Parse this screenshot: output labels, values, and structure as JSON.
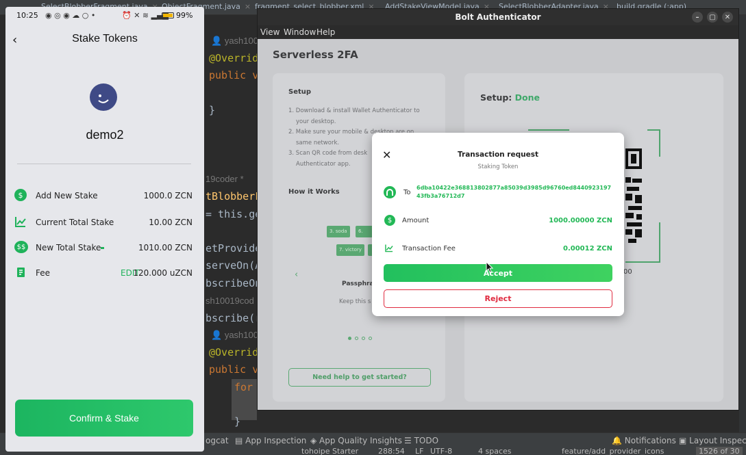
{
  "ide": {
    "tabs": [
      "SelectBlobberFragment.java",
      "ObjectFragment.java",
      "fragment_select_blobber.xml",
      "AddStakeViewModel.java",
      "SelectBlobberAdapter.java",
      "build.gradle (:app)"
    ],
    "code_lines": {
      "author1": "yash100",
      "override1": "@Overrid",
      "public1": "public v",
      "brace1": "}",
      "coder": "19coder *",
      "blobberF": "tBlobberF",
      "thisget": "= this.ge",
      "provide": "etProvide",
      "serveon": "serveOn(A",
      "subscribeon": "bscribeOn",
      "author2": "sh10019cod",
      "subscribe": "bscribe(r",
      "author3": "yash100",
      "override2": "@Overrid",
      "public2": "public v",
      "for": "for",
      "brace2": "}"
    },
    "tool_windows": [
      "ogcat",
      "App Inspection",
      "App Quality Insights",
      "TODO",
      "Notifications",
      "Layout Inspector"
    ],
    "status": [
      "tohoipe Starter",
      "288:54",
      "LF",
      "UTF-8",
      "4 spaces",
      "feature/add_provider_icons",
      "1526 of 30"
    ]
  },
  "phone": {
    "status_time": "10:25",
    "status_battery": "99%",
    "title": "Stake Tokens",
    "username": "demo2",
    "rows": [
      {
        "label": "Add New Stake",
        "value": "1000.0 ZCN"
      },
      {
        "label": "Current Total Stake",
        "value": "10.00 ZCN"
      },
      {
        "label": "New Total Stake",
        "value": "1010.00 ZCN"
      },
      {
        "label": "Fee",
        "edit": "EDIT",
        "value": "120.000 uZCN"
      }
    ],
    "confirm_label": "Confirm & Stake"
  },
  "bolt": {
    "window_title": "Bolt Authenticator",
    "menu": [
      "View",
      "Window",
      "Help"
    ],
    "heading": "Serverless 2FA",
    "setup_title": "Setup",
    "setup_steps": [
      "1. Download & install Wallet Authenticator to",
      "your desktop.",
      "2. Make sure your mobile & desktop are on",
      "same network.",
      "3. Scan QR code from desk",
      "Authenticator app."
    ],
    "how_title": "How it Works",
    "words": [
      "3. soda",
      "6. ma",
      "7. victory"
    ],
    "passphrase": "Passphra",
    "keep": "Keep this s",
    "help_btn": "Need help to get started?",
    "setup_done_label": "Setup:",
    "setup_done_value": "Done",
    "qr_caption": "00"
  },
  "modal": {
    "title": "Transaction request",
    "subtitle": "Staking Token",
    "to_label": "To",
    "to_address_1": "6dba10422e368813802877a85039d3985d96760ed8440923197",
    "to_address_2": "43fb3a76712d7",
    "amount_label": "Amount",
    "amount_value": "1000.00000 ZCN",
    "fee_label": "Transaction Fee",
    "fee_value": "0.00012 ZCN",
    "accept": "Accept",
    "reject": "Reject"
  },
  "colors": {
    "accent": "#22b856",
    "reject": "#e02a3f"
  }
}
